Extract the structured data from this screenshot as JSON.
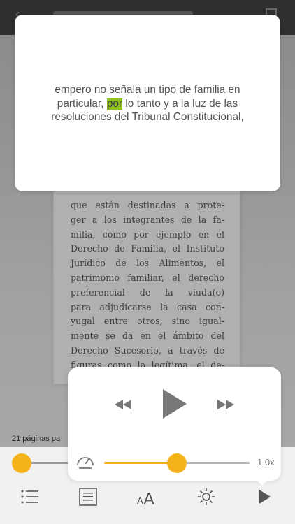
{
  "book": {
    "lines": [
      "que están destinadas a prote-",
      "ger a los integrantes de la fa-",
      "milia, como por ejemplo en el",
      "Derecho de Familia, el Instituto",
      "Jurídico de los Alimentos, el",
      "patrimonio familiar, el derecho",
      "preferencial de la viuda(o)",
      "para adjudicarse la casa con-",
      "yugal entre otros, sino igual-",
      "mente se da en el ámbito del",
      "Derecho Sucesorio, a través de",
      "figuras como la legítima, el de-"
    ],
    "pages_label": "21 páginas pa"
  },
  "popup": {
    "line1": "empero no señala un tipo de familia en",
    "line2_before": "particular, ",
    "line2_highlight": "por",
    "line2_after": " lo tanto y a la luz de las",
    "line3": "resoluciones del Tribunal Constitucional,"
  },
  "audio": {
    "speed_label": "1.0x",
    "speed_fraction": 0.5
  },
  "icons": {
    "rewind": "rewind-icon",
    "play": "play-icon",
    "forward": "fast-forward-icon",
    "speed": "speedometer-icon",
    "list": "list-icon",
    "page": "page-icon",
    "font": "font-size-icon",
    "brightness": "brightness-icon",
    "audio_play": "audio-play-icon"
  },
  "colors": {
    "accent": "#f5b31b",
    "highlight": "#8fc31f"
  }
}
